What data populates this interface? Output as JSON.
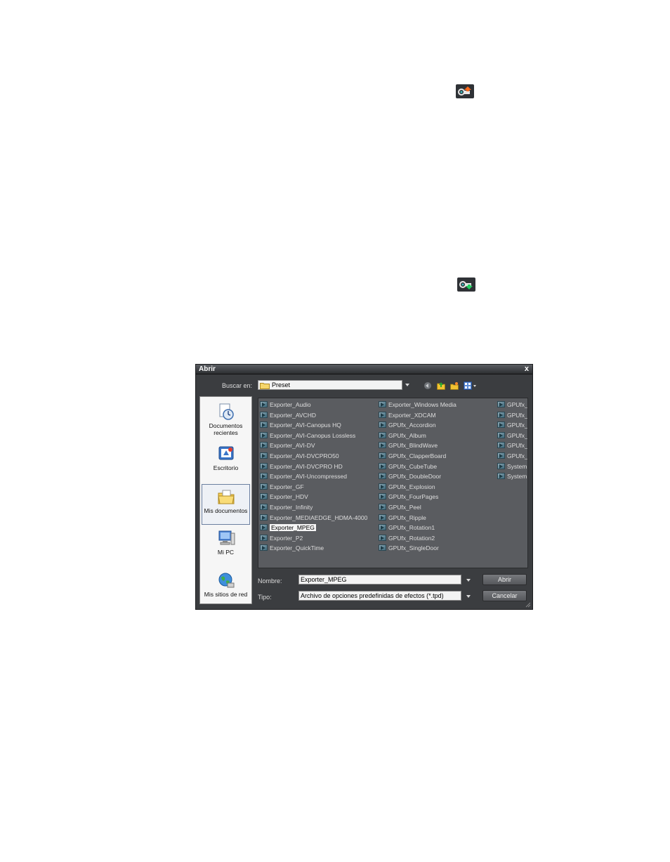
{
  "dialog": {
    "title": "Abrir",
    "close": "x",
    "look_in_label": "Buscar en:",
    "look_in_value": "Preset",
    "places": [
      {
        "label_line1": "Documentos",
        "label_line2": "recientes"
      },
      {
        "label_line1": "Escritorio",
        "label_line2": ""
      },
      {
        "label_line1": "Mis documentos",
        "label_line2": ""
      },
      {
        "label_line1": "Mi PC",
        "label_line2": ""
      },
      {
        "label_line1": "Mis sitios de red",
        "label_line2": ""
      }
    ],
    "files_col1": [
      "Exporter_Audio",
      "Exporter_AVCHD",
      "Exporter_AVI-Canopus HQ",
      "Exporter_AVI-Canopus Lossless",
      "Exporter_AVI-DV",
      "Exporter_AVI-DVCPRO50",
      "Exporter_AVI-DVCPRO HD",
      "Exporter_AVI-Uncompressed",
      "Exporter_GF",
      "Exporter_HDV",
      "Exporter_Infinity",
      "Exporter_MEDIAEDGE_HDMA-4000",
      "Exporter_MPEG",
      "Exporter_P2",
      "Exporter_QuickTime"
    ],
    "files_col2": [
      "Exporter_Windows Media",
      "Exporter_XDCAM",
      "GPUfx_Accordion",
      "GPUfx_Album",
      "GPUfx_BlindWave",
      "GPUfx_ClapperBoard",
      "GPUfx_CubeTube",
      "GPUfx_DoubleDoor",
      "GPUfx_Explosion",
      "GPUfx_FourPages",
      "GPUfx_Peel",
      "GPUfx_Ripple",
      "GPUfx_Rotation1",
      "GPUfx_Rotation2",
      "GPUfx_SingleDoor"
    ],
    "files_col3": [
      "GPUfx_",
      "GPUfx_",
      "GPUfx_",
      "GPUfx_",
      "GPUfx_",
      "GPUfx_",
      "System",
      "System"
    ],
    "selected_file": "Exporter_MPEG",
    "name_label": "Nombre:",
    "name_value": "Exporter_MPEG",
    "type_label": "Tipo:",
    "type_value": "Archivo de opciones predefinidas de efectos (*.tpd)",
    "open_label": "Abrir",
    "cancel_label": "Cancelar"
  },
  "icons": {
    "page_top": "export-preset-icon",
    "page_middle": "import-preset-icon"
  }
}
